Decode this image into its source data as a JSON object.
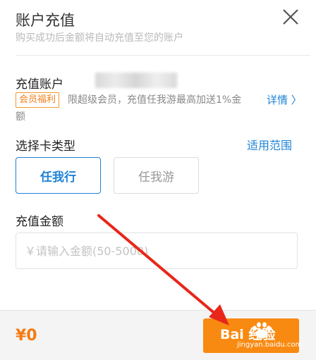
{
  "header": {
    "title": "账户充值",
    "subtitle": "购买成功后金额将自动充值至您的账户",
    "close_icon": "close-icon"
  },
  "account": {
    "label": "充值账户",
    "value_blurred": true
  },
  "benefit": {
    "badge": "会员福利",
    "text_line1": "限超级会员，充值任我游最高加送1%金",
    "text_line2": "额",
    "details_link": "详情 〉"
  },
  "card_type": {
    "label": "选择卡类型",
    "scope_link": "适用范围",
    "options": [
      {
        "label": "任我行",
        "selected": true
      },
      {
        "label": "任我游",
        "selected": false
      }
    ]
  },
  "amount": {
    "label": "充值金额",
    "placeholder": "￥请输入金额(50-5000)",
    "value": ""
  },
  "footer": {
    "total": "¥0",
    "watermark_main": "Bai 经验",
    "watermark_sub": "jingyan.baidu.com"
  },
  "colors": {
    "accent_blue": "#1e83d6",
    "accent_orange": "#f88a12",
    "annotation_red": "#e8261a"
  }
}
